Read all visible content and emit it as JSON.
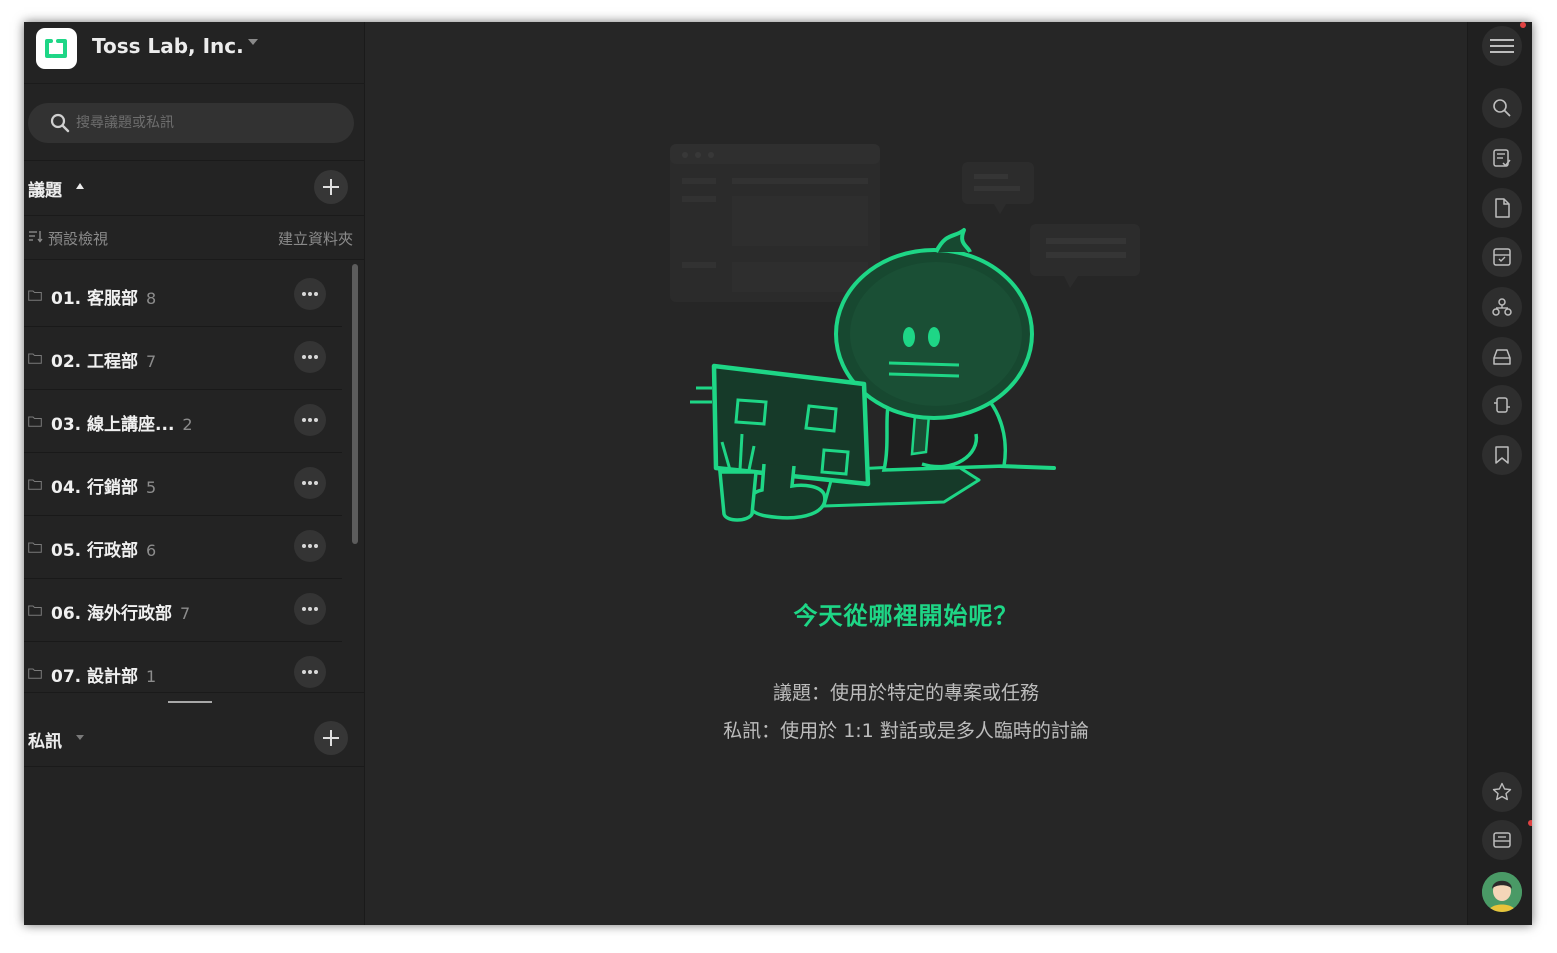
{
  "team": {
    "name": "Toss Lab, Inc."
  },
  "search": {
    "placeholder": "搜尋議題或私訊"
  },
  "topics": {
    "title": "議題",
    "default_view": "預設檢視",
    "create_folder": "建立資料夾",
    "folders": [
      {
        "name": "01. 客服部",
        "count": "8"
      },
      {
        "name": "02. 工程部",
        "count": "7"
      },
      {
        "name": "03. 線上講座...",
        "count": "2"
      },
      {
        "name": "04. 行銷部",
        "count": "5"
      },
      {
        "name": "05. 行政部",
        "count": "6"
      },
      {
        "name": "06. 海外行政部",
        "count": "7"
      },
      {
        "name": "07. 設計部",
        "count": "1"
      }
    ]
  },
  "messages": {
    "title": "私訊"
  },
  "main": {
    "heading": "今天從哪裡開始呢？",
    "desc_topics": "議題：使用於特定的專案或任務",
    "desc_messages": "私訊：使用於 1:1 對話或是多人臨時的討論"
  },
  "rail": {
    "icons": [
      "menu-icon",
      "search-icon",
      "task-list-icon",
      "file-icon",
      "archive-icon",
      "org-chart-icon",
      "inbox-icon",
      "integration-icon",
      "bookmark-icon",
      "star-icon",
      "message-box-icon",
      "user-avatar"
    ]
  },
  "colors": {
    "accent": "#1ed686",
    "background": "#262626",
    "sidebar": "#232323",
    "notification": "#e04242"
  }
}
